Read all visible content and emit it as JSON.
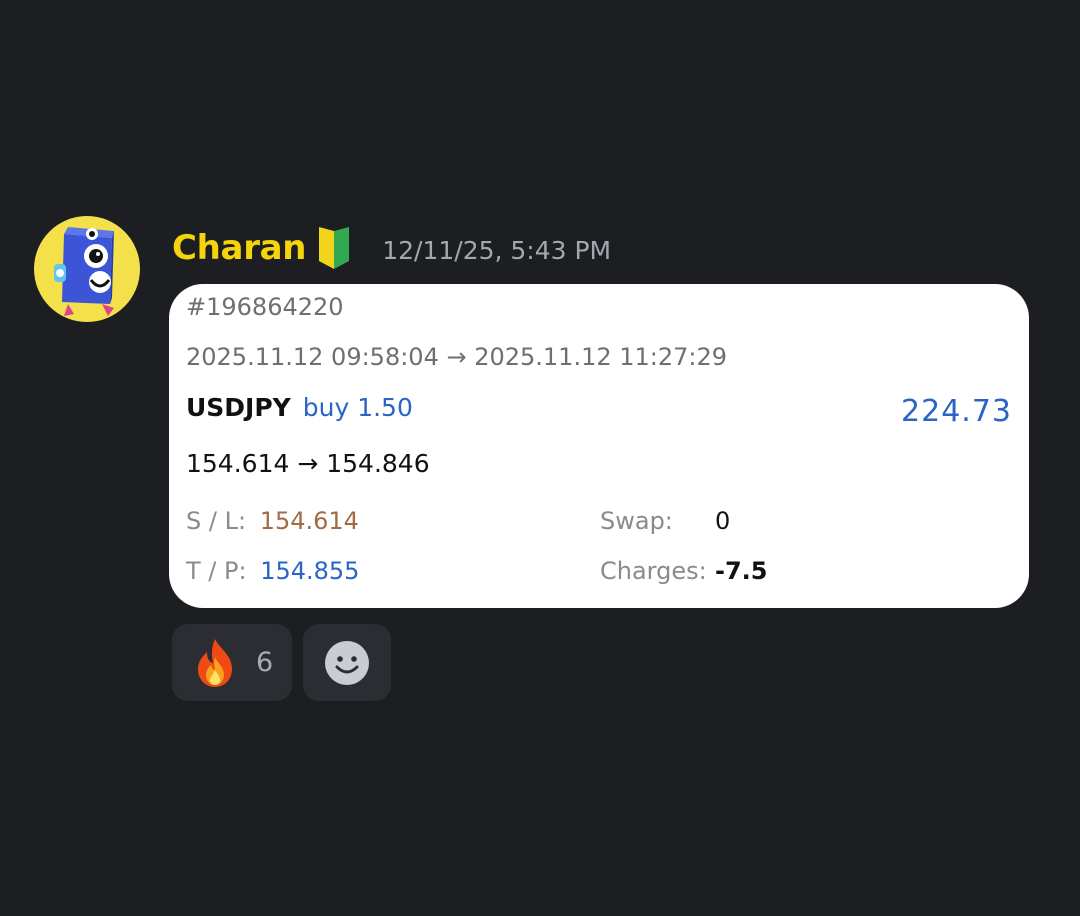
{
  "message": {
    "username": "Charan",
    "username_color": "#f5d40c",
    "badge_icon": "beginner-leaf-icon",
    "timestamp": "12/11/25, 5:43 PM"
  },
  "trade": {
    "ticket": "#196864220",
    "time_range": "2025.11.12 09:58:04 → 2025.11.12 11:27:29",
    "symbol": "USDJPY",
    "direction": "buy 1.50",
    "profit": "224.73",
    "price_range": "154.614 → 154.846",
    "sl_label": "S / L:",
    "sl_value": "154.614",
    "tp_label": "T / P:",
    "tp_value": "154.855",
    "swap_label": "Swap:",
    "swap_value": "0",
    "charges_label": "Charges:",
    "charges_value": "-7.5",
    "accent_color": "#2a64c7",
    "sl_color": "#a26b45"
  },
  "reactions": [
    {
      "icon": "fire-icon",
      "count": "6"
    },
    {
      "icon": "add-reaction-smiley-icon"
    }
  ]
}
